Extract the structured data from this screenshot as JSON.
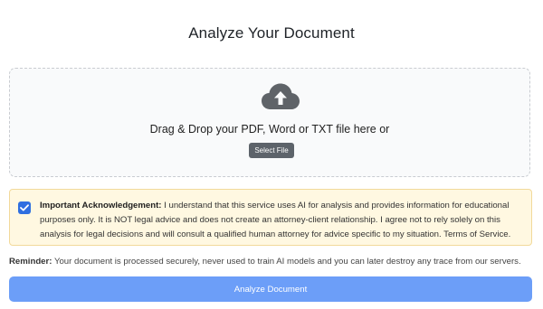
{
  "page": {
    "title": "Analyze Your Document"
  },
  "upload": {
    "icon": "cloud-upload-icon",
    "prompt": "Drag & Drop your PDF, Word or TXT file here or",
    "select_button_label": "Select File"
  },
  "acknowledgement": {
    "checked": true,
    "heading": "Important Acknowledgement:",
    "body": "I understand that this service uses AI for analysis and provides information for educational purposes only. It is NOT legal advice and does not create an attorney-client relationship. I agree not to rely solely on this analysis for legal decisions and will consult a qualified human attorney for advice specific to my situation. Terms of Service."
  },
  "reminder": {
    "label": "Reminder:",
    "text": "Your document is processed securely, never used to train AI models and you can later destroy any trace from our servers."
  },
  "actions": {
    "analyze_button_label": "Analyze Document"
  },
  "colors": {
    "accent": "#2f6fe0",
    "analyze_button": "#6c9ef8",
    "select_button": "#5d636a",
    "warning_background": "#fff8e1",
    "cloud_icon": "#5f6368"
  }
}
